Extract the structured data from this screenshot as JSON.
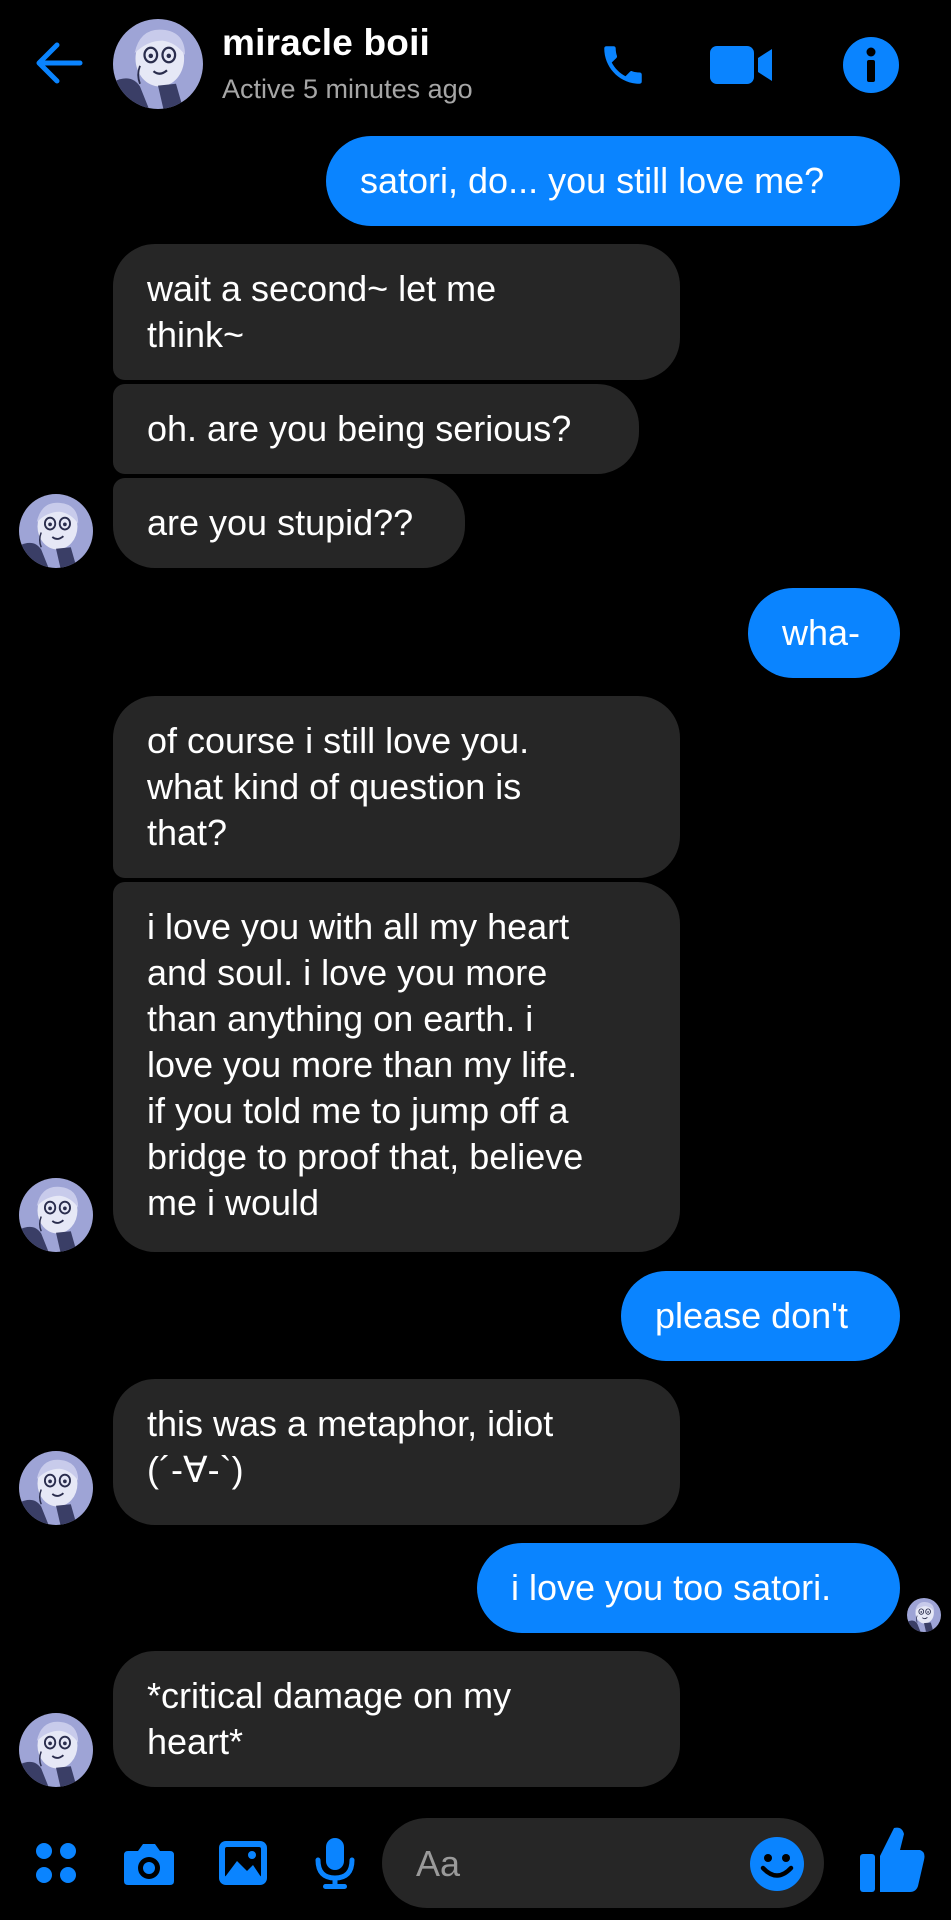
{
  "header": {
    "contact_name": "miracle boii",
    "status": "Active 5 minutes ago",
    "icons": [
      "back-arrow-icon",
      "phone-icon",
      "video-camera-icon",
      "info-icon"
    ]
  },
  "messages": [
    {
      "from": "me",
      "text": "satori, do... you still love me?"
    },
    {
      "from": "them",
      "text": "wait a second~ let me\nthink~"
    },
    {
      "from": "them",
      "text": "oh. are you being serious?"
    },
    {
      "from": "them",
      "text": "are you stupid??"
    },
    {
      "from": "me",
      "text": "wha-"
    },
    {
      "from": "them",
      "text": "of course i still love you.\nwhat kind of question is\nthat?"
    },
    {
      "from": "them",
      "text": "i love you with all my heart\nand soul. i love you more\nthan anything on earth. i\nlove you more than my life.\nif you told me to jump off a\nbridge to proof that,  believe\nme i would"
    },
    {
      "from": "me",
      "text": "please don't"
    },
    {
      "from": "them",
      "text": "this was a metaphor, idiot\n(´-∀-`)"
    },
    {
      "from": "me",
      "text": "i love you too satori."
    },
    {
      "from": "them",
      "text": "*critical damage on my\nheart*"
    }
  ],
  "composer": {
    "placeholder": "Aa",
    "icons": [
      "menu-dots-icon",
      "camera-icon",
      "gallery-icon",
      "microphone-icon",
      "emoji-icon",
      "thumbs-up-icon"
    ]
  },
  "colors": {
    "accent": "#0a84ff",
    "background": "#000000",
    "received_bubble": "#262626",
    "secondary_text": "#a6a6a6"
  }
}
